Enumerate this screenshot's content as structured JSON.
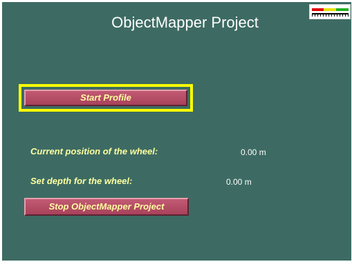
{
  "app": {
    "title": "ObjectMapper Project"
  },
  "status_indicator": {
    "icon": "signal-level-meter-icon",
    "colors": [
      "#e00000",
      "#e8e000",
      "#20b020"
    ]
  },
  "buttons": {
    "start_label": "Start Profile",
    "stop_label": "Stop ObjectMapper Project"
  },
  "fields": {
    "current_position": {
      "label": "Current position of the wheel:",
      "value": "0.00 m"
    },
    "set_depth": {
      "label": "Set depth for the wheel:",
      "value": "0.00 m"
    }
  },
  "colors": {
    "background": "#3d6b63",
    "button": "#b24d66",
    "label_text": "#ffffa0",
    "focus_outline": "#ffff00"
  }
}
